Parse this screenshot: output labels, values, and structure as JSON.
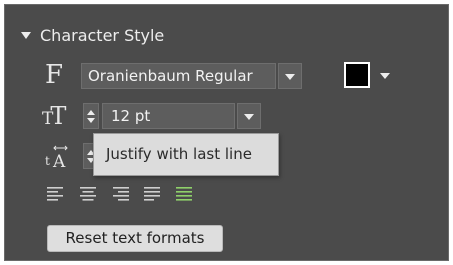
{
  "section": {
    "title": "Character Style"
  },
  "font": {
    "family": "Oranienbaum Regular"
  },
  "size": {
    "value": "12 pt"
  },
  "color": {
    "text_color": "#000000"
  },
  "tooltip": {
    "text": "Justify with last line"
  },
  "alignment": {
    "options": [
      "align-left",
      "align-center",
      "align-right",
      "justify",
      "justify-with-last-line"
    ],
    "selected": "justify-with-last-line"
  },
  "buttons": {
    "reset_label": "Reset text formats"
  },
  "colors": {
    "panel_bg": "#4b4b4b",
    "selected_align": "#8fd16a",
    "icon": "#cfcfcf"
  }
}
